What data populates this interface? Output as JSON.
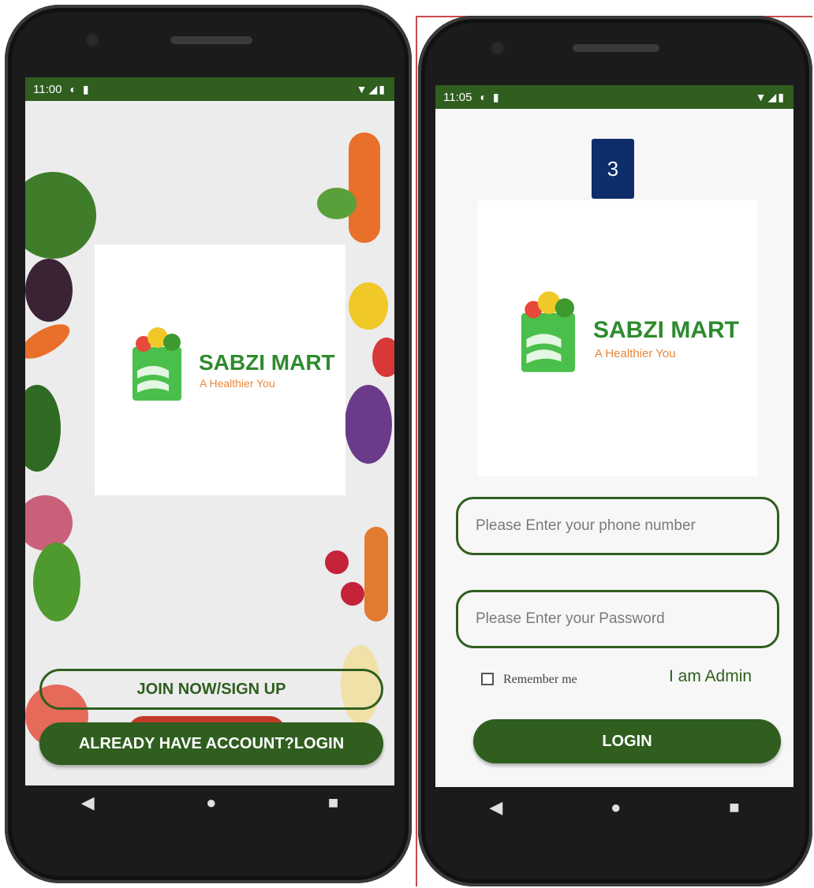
{
  "welcome_screen": {
    "status": {
      "time": "11:00",
      "icons": [
        "data-saver-icon",
        "sim-card-icon"
      ],
      "right_icons": "wifi signal battery"
    },
    "logo": {
      "title": "SABZI MART",
      "tagline": "A Healthier You"
    },
    "join_button": "JOIN NOW/SIGN UP",
    "login_button": "ALREADY HAVE ACCOUNT?LOGIN"
  },
  "login_screen": {
    "status": {
      "time": "11:05"
    },
    "badge": "3",
    "logo": {
      "title": "SABZI MART",
      "tagline": "A Healthier You"
    },
    "phone_field": {
      "placeholder": "Please Enter your phone number",
      "value": ""
    },
    "password_field": {
      "placeholder": "Please Enter your Password",
      "value": ""
    },
    "remember_me": "Remember me",
    "admin_link": "I am Admin",
    "login_button": "LOGIN"
  },
  "colors": {
    "primary": "#2f5e1f",
    "brand_green": "#2e8b2e",
    "tagline_orange": "#e8873a",
    "badge_blue": "#0d2d6b"
  }
}
